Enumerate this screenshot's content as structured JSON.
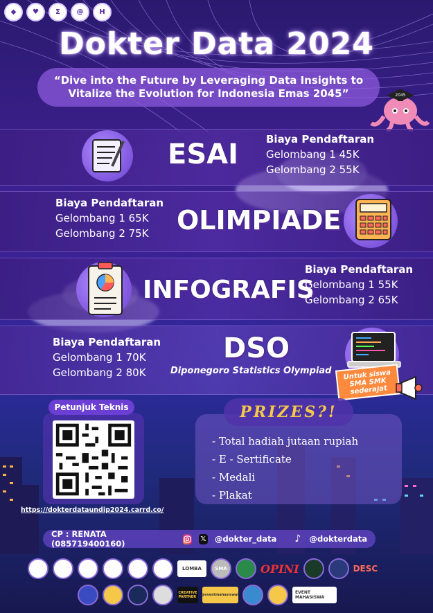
{
  "header": {
    "title": "Dokter Data 2024",
    "tagline": "“Dive into the Future by Leveraging Data Insights to Vitalize the Evolution for Indonesia Emas 2045”",
    "mascot_label": "2045"
  },
  "events": [
    {
      "name": "ESAI",
      "fee_heading": "Biaya Pendaftaran",
      "wave1": "Gelombang 1 45K",
      "wave2": "Gelombang 2 55K"
    },
    {
      "name": "OLIMPIADE",
      "fee_heading": "Biaya Pendaftaran",
      "wave1": "Gelombang 1 65K",
      "wave2": "Gelombang 2 75K"
    },
    {
      "name": "INFOGRAFIS",
      "fee_heading": "Biaya Pendaftaran",
      "wave1": "Gelombang 1 55K",
      "wave2": "Gelombang 2 65K"
    },
    {
      "name": "DSO",
      "subtitle": "Diponegoro Statistics Olympiad",
      "fee_heading": "Biaya Pendaftaran",
      "wave1": "Gelombang 1 70K",
      "wave2": "Gelombang 2 80K",
      "badge": "Untuk siswa SMA SMK sederajat"
    }
  ],
  "technical": {
    "label": "Petunjuk Teknis",
    "link": "https://dokterdataundip2024.carrd.co/"
  },
  "prizes": {
    "title": "PRIZES?!",
    "items": [
      "- Total hadiah jutaan rupiah",
      "- E - Sertificate",
      "- Medali",
      "- Plakat"
    ]
  },
  "contact": {
    "cp": "CP : RENATA (085719400160)",
    "instagram": "@dokter_data",
    "tiktok": "@dokterdata"
  },
  "sponsors": {
    "lomba": "LOMBA",
    "sma": "SMA",
    "opini": "OPINI",
    "desc": "DESC",
    "creative": "CREATIVE PARTNER",
    "eventmahasiswa": "@eventmahasiswa8",
    "event": "EVENT MAHASISWA"
  },
  "colors": {
    "accent": "#6b3fd4",
    "prize_gold": "#f5c84a",
    "background_top": "#2a1a6e",
    "background_bottom": "#17184f"
  },
  "icons": [
    "paper-pen-icon",
    "calculator-icon",
    "clipboard-chart-icon",
    "laptop-icon",
    "megaphone-icon",
    "instagram-icon",
    "x-icon",
    "tiktok-icon",
    "qr-code-icon"
  ]
}
